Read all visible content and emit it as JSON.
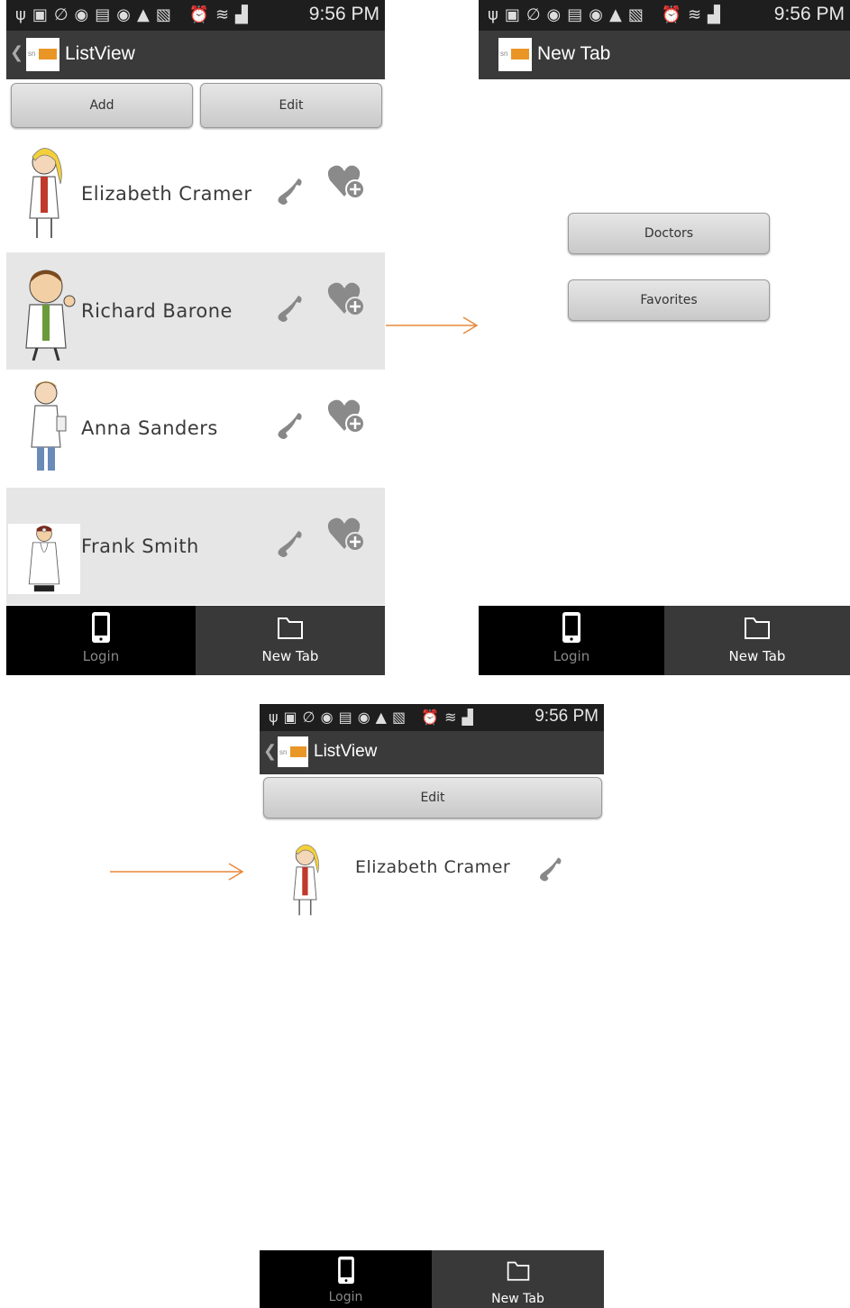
{
  "status_bar": {
    "icons": "ψ▣∅◉▤◉▲▧ ⏰≋▟",
    "time": "9:56 PM"
  },
  "screen_listview": {
    "title": "ListView",
    "logo_text": "sn",
    "buttons": {
      "add": "Add",
      "edit": "Edit"
    },
    "items": [
      {
        "name": "Elizabeth Cramer"
      },
      {
        "name": "Richard Barone"
      },
      {
        "name": "Anna Sanders"
      },
      {
        "name": "Frank Smith"
      }
    ]
  },
  "screen_newtab": {
    "title": "New Tab",
    "logo_text": "sn",
    "buttons": {
      "doctors": "Doctors",
      "favorites": "Favorites"
    }
  },
  "screen_favorites": {
    "title": "ListView",
    "logo_text": "sn",
    "buttons": {
      "edit": "Edit"
    },
    "items": [
      {
        "name": "Elizabeth Cramer"
      }
    ]
  },
  "tabs": {
    "login": "Login",
    "new_tab": "New Tab"
  },
  "colors": {
    "arrow": "#e8893a",
    "statusbar": "#1e1e1e",
    "actionbar": "#3a3a3a",
    "logo_accent": "#e99627"
  },
  "icons": [
    "back-chevron-icon",
    "app-logo-icon",
    "phone-call-icon",
    "heart-add-icon",
    "mobile-phone-icon",
    "folder-icon",
    "arrow-right-icon"
  ]
}
